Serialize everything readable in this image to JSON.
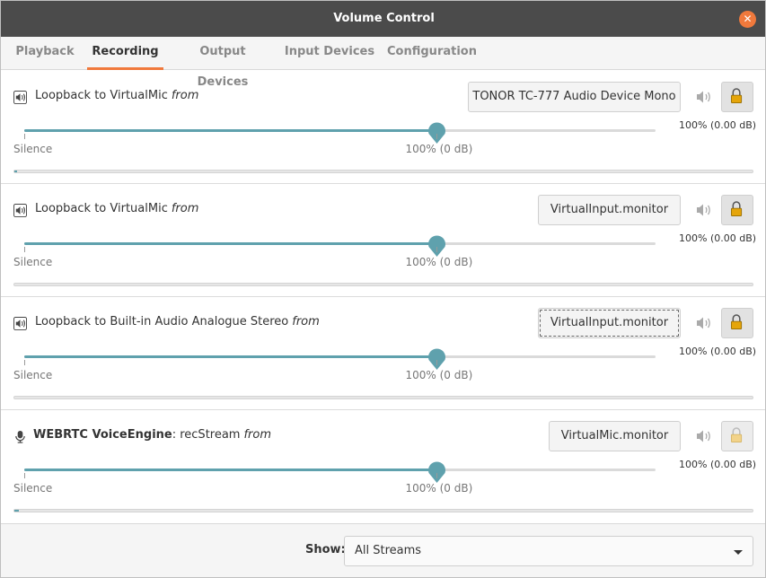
{
  "window": {
    "title": "Volume Control"
  },
  "tabs": [
    {
      "label": "Playback",
      "active": false
    },
    {
      "label": "Recording",
      "active": true
    },
    {
      "label": "Output Devices",
      "active": false
    },
    {
      "label": "Input Devices",
      "active": false
    },
    {
      "label": "Configuration",
      "active": false
    }
  ],
  "colors": {
    "accent": "#f0793c",
    "slider": "#5fa1ad",
    "titlebar": "#4b4b4b",
    "lock": "#e5a50a"
  },
  "scale": {
    "silence": "Silence",
    "unity": "100% (0 dB)"
  },
  "streams": [
    {
      "icon": "speaker-app-icon",
      "name": "Loopback to VirtualMic",
      "app": "",
      "from": "from",
      "device": "TONOR TC-777 Audio Device Mono",
      "volume_label": "100% (0.00 dB)",
      "volume": 1.0,
      "peak": 0.004,
      "locked": true,
      "lock_enabled": true
    },
    {
      "icon": "speaker-app-icon",
      "name": "Loopback to VirtualMic",
      "app": "",
      "from": "from",
      "device": "VirtualInput.monitor",
      "volume_label": "100% (0.00 dB)",
      "volume": 1.0,
      "peak": 0.0,
      "locked": true,
      "lock_enabled": true
    },
    {
      "icon": "speaker-app-icon",
      "name": "Loopback to Built-in Audio Analogue Stereo",
      "app": "",
      "from": "from",
      "device": "VirtualInput.monitor",
      "volume_label": "100% (0.00 dB)",
      "volume": 1.0,
      "peak": 0.0,
      "locked": true,
      "lock_enabled": true
    },
    {
      "icon": "microphone-icon",
      "name": "WEBRTC VoiceEngine",
      "app": ": recStream",
      "from": "from",
      "device": "VirtualMic.monitor",
      "volume_label": "100% (0.00 dB)",
      "volume": 1.0,
      "peak": 0.006,
      "locked": true,
      "lock_enabled": false
    }
  ],
  "footer": {
    "show_label": "Show:",
    "show_value": "All Streams"
  }
}
